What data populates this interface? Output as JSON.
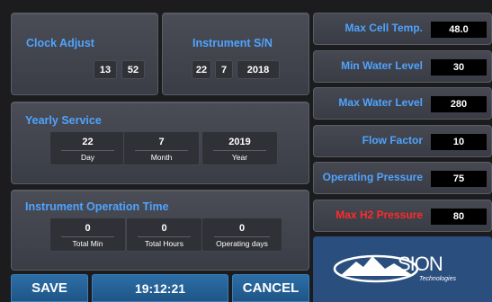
{
  "clock_adjust": {
    "title": "Clock Adjust",
    "hour": "13",
    "minute": "52"
  },
  "instrument_sn": {
    "title": "Instrument S/N",
    "a": "22",
    "b": "7",
    "c": "2018"
  },
  "yearly_service": {
    "title": "Yearly Service",
    "fields": [
      {
        "value": "22",
        "label": "Day"
      },
      {
        "value": "7",
        "label": "Month"
      },
      {
        "value": "2019",
        "label": "Year"
      }
    ]
  },
  "operation_time": {
    "title": "Instrument Operation Time",
    "fields": [
      {
        "value": "0",
        "label": "Total Min"
      },
      {
        "value": "0",
        "label": "Total Hours"
      },
      {
        "value": "0",
        "label": "Operating days"
      }
    ]
  },
  "settings": [
    {
      "label": "Max Cell Temp.",
      "value": "48.0",
      "color": "#4fa3ff"
    },
    {
      "label": "Min Water Level",
      "value": "30",
      "color": "#4fa3ff"
    },
    {
      "label": "Max Water Level",
      "value": "280",
      "color": "#4fa3ff"
    },
    {
      "label": "Flow Factor",
      "value": "10",
      "color": "#4fa3ff"
    },
    {
      "label": "Operating Pressure",
      "value": "75",
      "color": "#4fa3ff"
    },
    {
      "label": "Max H2 Pressure",
      "value": "80",
      "color": "#ff2a2a"
    }
  ],
  "footer": {
    "save": "SAVE",
    "clock": "19:12:21",
    "cancel": "CANCEL"
  },
  "logo": {
    "name": "SION",
    "tagline": "Technologies",
    "panel_color": "#2a4e7e"
  }
}
